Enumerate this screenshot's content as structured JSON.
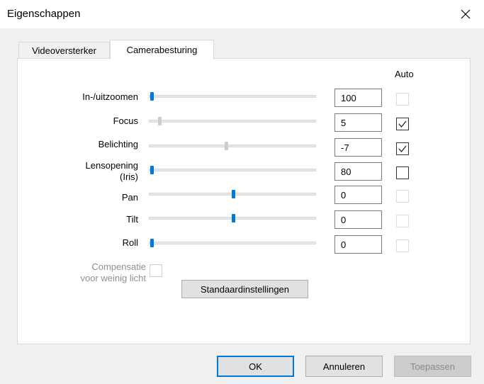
{
  "window": {
    "title": "Eigenschappen"
  },
  "tabs": [
    {
      "label": "Videoversterker",
      "selected": false
    },
    {
      "label": "Camerabesturing",
      "selected": true
    }
  ],
  "auto_header": "Auto",
  "controls": [
    {
      "label": "In-/uitzoomen",
      "value": "100",
      "slider_level": 0.0,
      "slider_enabled": true,
      "auto_enabled": false,
      "auto_checked": false
    },
    {
      "label": "Focus",
      "value": "5",
      "slider_level": 0.05,
      "slider_enabled": false,
      "auto_enabled": true,
      "auto_checked": true
    },
    {
      "label": "Belichting",
      "value": "-7",
      "slider_level": 0.46,
      "slider_enabled": false,
      "auto_enabled": true,
      "auto_checked": true
    },
    {
      "label_line1": "Lensopening",
      "label_line2": "(Iris)",
      "value": "80",
      "slider_level": 0.0,
      "slider_enabled": true,
      "auto_enabled": true,
      "auto_checked": false
    },
    {
      "label": "Pan",
      "value": "0",
      "slider_level": 0.5,
      "slider_enabled": true,
      "auto_enabled": false,
      "auto_checked": false
    },
    {
      "label": "Tilt",
      "value": "0",
      "slider_level": 0.5,
      "slider_enabled": true,
      "auto_enabled": false,
      "auto_checked": false
    },
    {
      "label": "Roll",
      "value": "0",
      "slider_level": 0.0,
      "slider_enabled": true,
      "auto_enabled": false,
      "auto_checked": false
    }
  ],
  "low_light": {
    "label_line1": "Compensatie",
    "label_line2": "voor weinig licht",
    "checked": false,
    "enabled": false
  },
  "defaults_button": "Standaardinstellingen",
  "buttons": {
    "ok": "OK",
    "cancel": "Annuleren",
    "apply": "Toepassen"
  },
  "icons": {
    "close": "close-icon",
    "check": "checkmark-icon"
  },
  "colors": {
    "accent": "#0078d7",
    "panel_bg": "#ffffff",
    "dialog_bg": "#f0f0f0"
  }
}
